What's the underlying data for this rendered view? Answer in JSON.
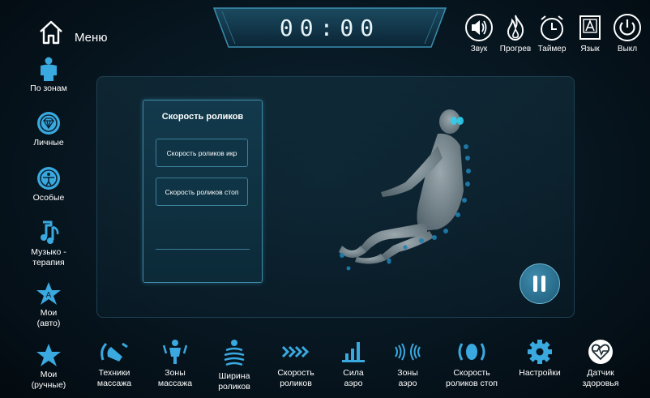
{
  "header": {
    "menu_label": "Меню",
    "timer": "00:00",
    "buttons": [
      {
        "label": "Звук",
        "icon": "speaker-icon"
      },
      {
        "label": "Прогрев",
        "icon": "flame-icon"
      },
      {
        "label": "Таймер",
        "icon": "alarm-clock-icon"
      },
      {
        "label": "Язык",
        "icon": "language-icon"
      },
      {
        "label": "Выкл",
        "icon": "power-icon"
      }
    ]
  },
  "sidebar": {
    "items": [
      {
        "label": "По зонам",
        "icon": "body-zones-icon"
      },
      {
        "label": "Личные",
        "icon": "diamond-icon"
      },
      {
        "label": "Особые",
        "icon": "person-circle-icon"
      },
      {
        "label": "Музыко -\nтерапия",
        "icon": "music-note-icon"
      },
      {
        "label": "Мои\n(авто)",
        "icon": "star-a-icon"
      },
      {
        "label": "Мои\n(ручные)",
        "icon": "star-icon"
      }
    ]
  },
  "submenu": {
    "title": "Скорость роликов",
    "options": [
      "Скорость роликов икр",
      "Скорость роликов стоп"
    ]
  },
  "bottom_bar": {
    "items": [
      {
        "label": "Техники\nмассажа",
        "icon": "massage-technique-icon"
      },
      {
        "label": "Зоны\nмассажа",
        "icon": "massage-zones-icon"
      },
      {
        "label": "Ширина\nроликов",
        "icon": "roller-width-icon"
      },
      {
        "label": "Скорость\nроликов",
        "icon": "roller-speed-icon"
      },
      {
        "label": "Сила\nаэро",
        "icon": "air-strength-icon"
      },
      {
        "label": "Зоны\nаэро",
        "icon": "air-zones-icon"
      },
      {
        "label": "Скорость\nроликов стоп",
        "icon": "foot-roller-speed-icon"
      },
      {
        "label": "Настройки",
        "icon": "gear-icon"
      },
      {
        "label": "Датчик\nздоровья",
        "icon": "heart-sensor-icon"
      }
    ]
  },
  "colors": {
    "accent": "#3aa9e0",
    "panel_border": "#3d8aa6"
  }
}
